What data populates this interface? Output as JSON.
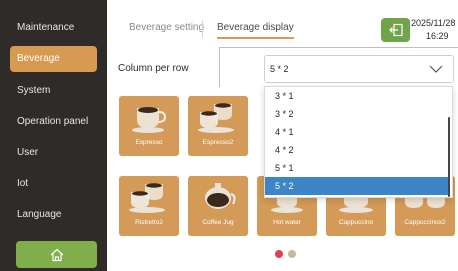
{
  "sidebar": {
    "items": [
      {
        "label": "Maintenance",
        "active": false
      },
      {
        "label": "Beverage",
        "active": true
      },
      {
        "label": "System",
        "active": false
      },
      {
        "label": "Operation panel",
        "active": false
      },
      {
        "label": "User",
        "active": false
      },
      {
        "label": "Iot",
        "active": false
      },
      {
        "label": "Language",
        "active": false
      }
    ],
    "home_icon": "home-icon"
  },
  "header": {
    "tabs": [
      {
        "label": "Beverage setting",
        "active": false
      },
      {
        "label": "Beverage display",
        "active": true
      }
    ],
    "exit_icon": "exit-icon",
    "date": "2025/11/28",
    "time": "16:29"
  },
  "settings": {
    "column_per_row_label": "Column per row",
    "selected_value": "5 * 2",
    "options": [
      "3 * 1",
      "3 * 2",
      "4 * 1",
      "4 * 2",
      "5 * 1",
      "5 * 2"
    ]
  },
  "tiles": [
    {
      "label": "Espresso",
      "icon": "single-cup-icon"
    },
    {
      "label": "Espresso2",
      "icon": "double-cup-icon"
    },
    {
      "label": "Ristretto2",
      "icon": "double-cup-icon"
    },
    {
      "label": "Coffee Jug",
      "icon": "jug-icon"
    },
    {
      "label": "Hot water",
      "icon": "hot-water-icon"
    },
    {
      "label": "Cappuccino",
      "icon": "cappuccino-icon"
    },
    {
      "label": "Cappuccinox2",
      "icon": "double-cappuccino-icon"
    }
  ],
  "colors": {
    "accent": "#d79a52",
    "sidebar": "#2e2b28",
    "green": "#7fae4a",
    "selected_option": "#3d85c6",
    "page_dot_active": "#e0404f",
    "page_dot_inactive": "#c9b79c"
  },
  "pagination": {
    "pages": 2,
    "current": 1
  }
}
